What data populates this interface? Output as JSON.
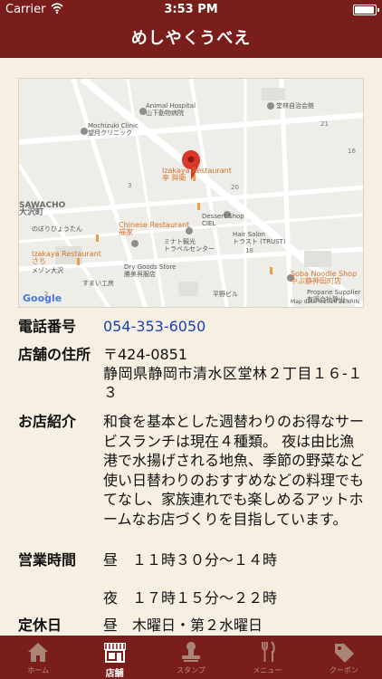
{
  "status_bar": {
    "carrier": "Carrier",
    "time": "3:53 PM",
    "battery_level": 1.0
  },
  "nav": {
    "title": "めしやくうべえ"
  },
  "map": {
    "labels": {
      "animal_hospital": "Animal Hospital\n山下動物病院",
      "dojo": "堂林自治会館",
      "mochizuki": "Mochizuki Clinic\n望月クリニック",
      "izakaya1": "Izakaya Restaurant\n亭 與衛",
      "sawacho": "SAWACHO\n大沢町",
      "dessert": "Dessert Shop\nCIEL",
      "nobori": "のぼりひょうたん",
      "chinese": "Chinese Restaurant\n福家",
      "hair": "Hair Salon\nトラスト (TRUST)",
      "izakaya2": "Izakaya Restaurant\nさち",
      "travel": "ミナト観光\nトラベルセンター",
      "menson": "メゾン大沢",
      "drygoods": "Dry Goods Store\n勝美呉服店",
      "sumai": "すまい工房",
      "soba": "Soba Noodle Shop\nやぶ静神田町店",
      "propane": "Propane Supplier\n有限会社静山",
      "hirano": "平野ビル"
    },
    "google": "Google",
    "attribution": "Map data ©2016 ZENRIN"
  },
  "info": {
    "phone_label": "電話番号",
    "phone": "054-353-6050",
    "address_label": "店舗の住所",
    "postal": "〒424-0851",
    "address": "静岡県静岡市清水区堂林２丁目１６-１３",
    "intro_label": "お店紹介",
    "intro": "和食を基本とした週替わりのお得なサービスランチは現在４種類。 夜は由比漁港で水揚げされる地魚、季節の野菜など使い日替わりのおすすめなどの料理でもてなし、家族連れでも楽しめるアットホームなお店づくりを目指しています。",
    "hours_label": "営業時間",
    "hours_lunch": "昼　１１時３０分～１４時",
    "hours_dinner": "夜　１７時１５分～２２時",
    "closed_label": "定休日",
    "closed": "昼　木曜日・第２水曜日"
  },
  "tabs": [
    {
      "label": "ホーム",
      "icon": "home-icon"
    },
    {
      "label": "店舗",
      "icon": "shop-icon"
    },
    {
      "label": "スタンプ",
      "icon": "stamp-icon"
    },
    {
      "label": "メニュー",
      "icon": "menu-icon"
    },
    {
      "label": "クーポン",
      "icon": "coupon-icon"
    }
  ],
  "colors": {
    "brand": "#7a1e1c",
    "background": "#f6efe2",
    "link": "#1a3fb3",
    "marker": "#d8372a"
  }
}
